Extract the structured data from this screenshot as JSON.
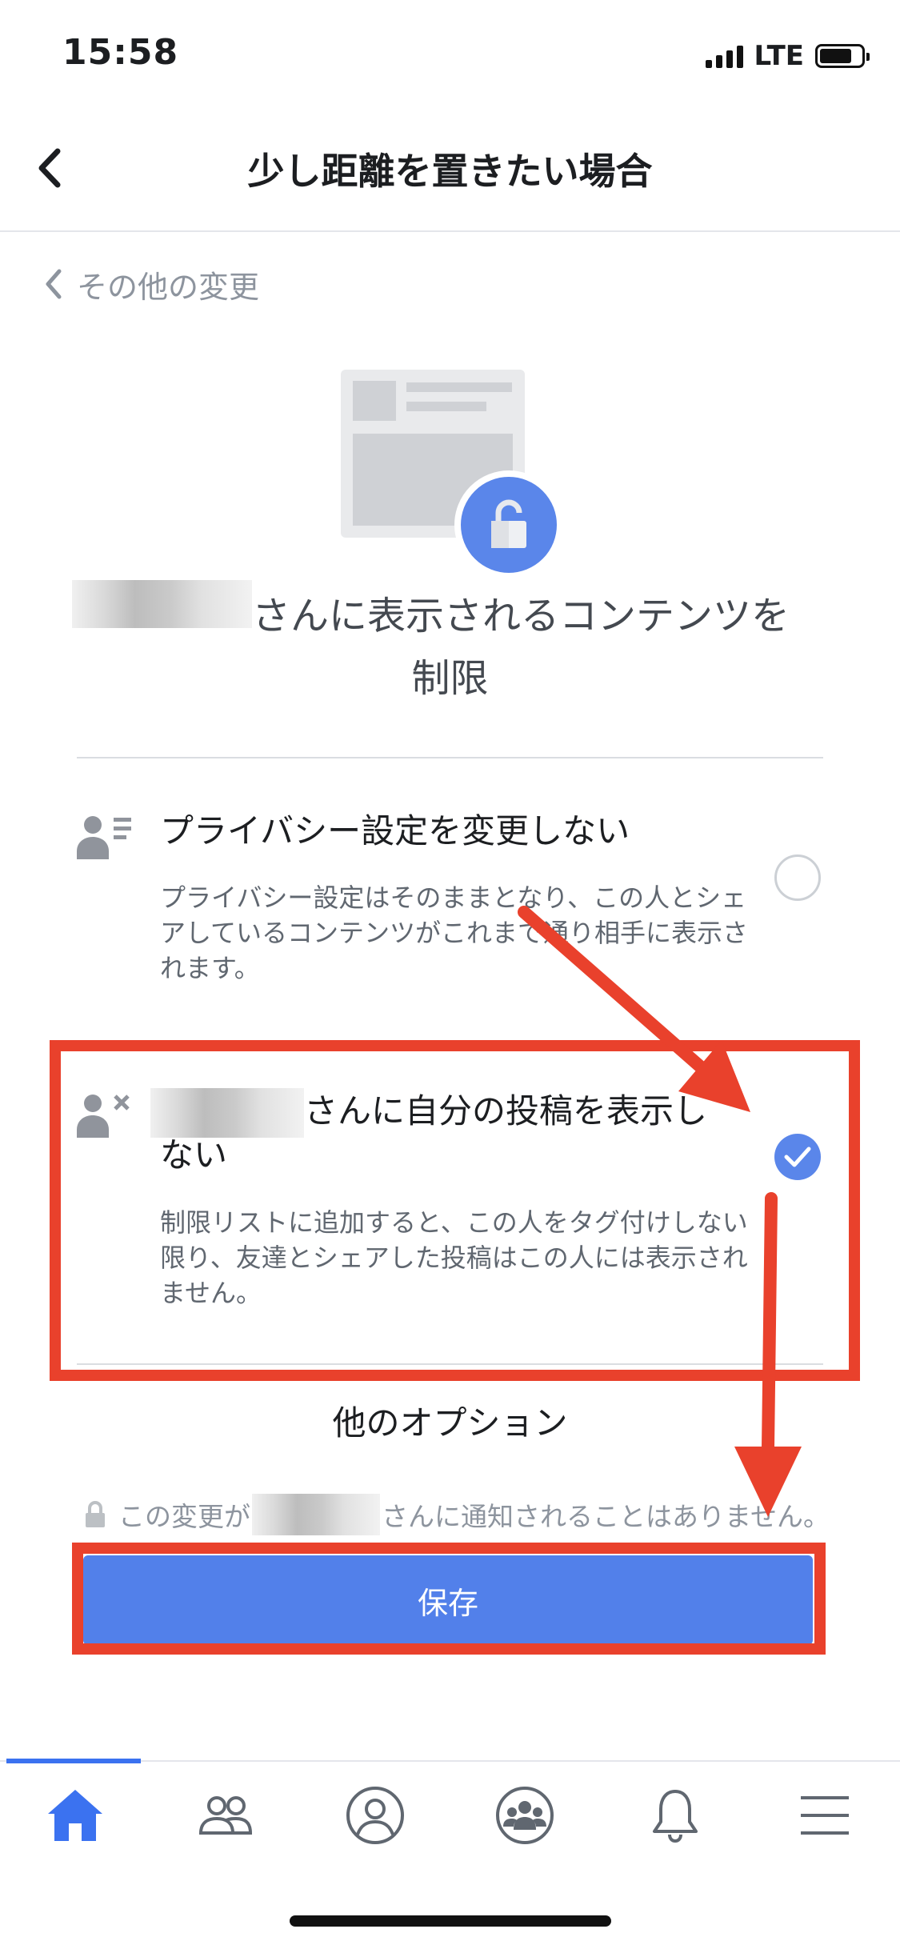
{
  "status_bar": {
    "time": "15:58",
    "network": "LTE",
    "battery_level": 0.7
  },
  "header": {
    "title": "少し距離を置きたい場合"
  },
  "breadcrumb": {
    "label": "その他の変更"
  },
  "page_title": {
    "line1_suffix": "さんに表示されるコンテンツを",
    "line2": "制限"
  },
  "options": [
    {
      "title": "プライバシー設定を変更しない",
      "description": "プライバシー設定はそのままとなり、この人とシェアしているコンテンツがこれまで通り相手に表示されます。",
      "selected": false,
      "icon": "person-list-icon"
    },
    {
      "title_suffix_line1": "さんに自分の投稿を表示し",
      "title_line2": "ない",
      "description": "制限リストに追加すると、この人をタグ付けしない限り、友達とシェアした投稿はこの人には表示されません。",
      "selected": true,
      "icon": "person-x-icon"
    }
  ],
  "other_options": {
    "label": "他のオプション"
  },
  "notice": {
    "prefix": "この変更が",
    "suffix": "さんに通知されることはありません。"
  },
  "save_button": {
    "label": "保存"
  },
  "colors": {
    "accent": "#5280ea",
    "annotation": "#e9412c",
    "nav_active": "#3b72f0"
  },
  "bottom_nav": {
    "active": "home",
    "items": [
      "home-icon",
      "friends-icon",
      "profile-icon",
      "groups-icon",
      "notifications-icon",
      "menu-icon"
    ]
  }
}
